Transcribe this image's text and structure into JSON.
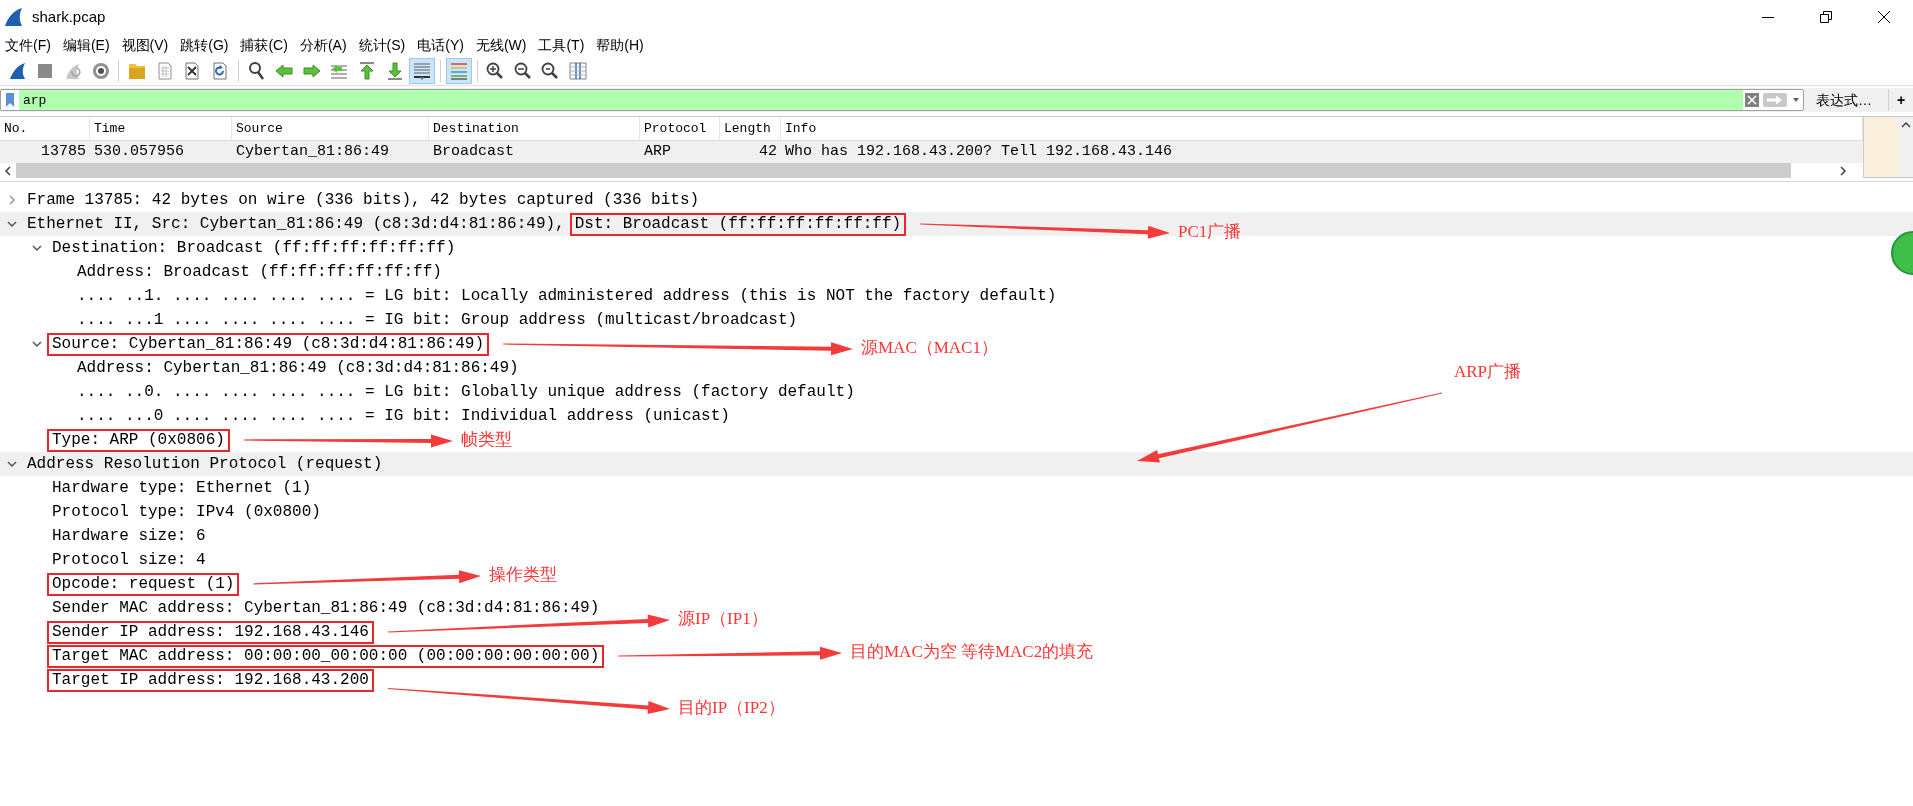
{
  "window": {
    "title": "shark.pcap"
  },
  "menu": [
    "文件(F)",
    "编辑(E)",
    "视图(V)",
    "跳转(G)",
    "捕获(C)",
    "分析(A)",
    "统计(S)",
    "电话(Y)",
    "无线(W)",
    "工具(T)",
    "帮助(H)"
  ],
  "toolbar": {
    "groups": [
      [
        {
          "selected": false
        },
        {
          "selected": false
        },
        {
          "selected": false
        },
        {
          "selected": false
        }
      ],
      [
        {
          "selected": false
        },
        {
          "selected": false
        },
        {
          "selected": false
        },
        {
          "selected": false
        }
      ],
      [
        {
          "selected": false
        },
        {
          "selected": false
        },
        {
          "selected": false
        },
        {
          "selected": false
        },
        {
          "selected": false
        },
        {
          "selected": false
        },
        {
          "selected": true
        }
      ],
      [
        {
          "selected": true
        }
      ],
      [
        {
          "selected": false
        },
        {
          "selected": false
        },
        {
          "selected": false
        },
        {
          "selected": false
        }
      ]
    ]
  },
  "filter": {
    "value": "arp",
    "expression_button": "表达式…",
    "add_button": "+"
  },
  "packet_list": {
    "columns": [
      "No.",
      "Time",
      "Source",
      "Destination",
      "Protocol",
      "Length",
      "Info"
    ],
    "rows": [
      {
        "cells": [
          "13785",
          "530.057956",
          "Cybertan_81:86:49",
          "Broadcast",
          "ARP",
          "42",
          "Who has 192.168.43.200? Tell 192.168.43.146"
        ]
      }
    ]
  },
  "details": [
    {
      "text": "Frame 13785: 42 bytes on wire (336 bits), 42 bytes captured (336 bits)",
      "expanded": false,
      "shaded": false,
      "boxed": false
    },
    {
      "text": "Ethernet II, Src: Cybertan_81:86:49 (c8:3d:d4:81:86:49),",
      "boxed_text": "Dst: Broadcast (ff:ff:ff:ff:ff:ff)",
      "expanded": true,
      "shaded": true,
      "boxed": false,
      "children": [
        {
          "text": "Destination: Broadcast (ff:ff:ff:ff:ff:ff)",
          "expanded": true,
          "boxed": false,
          "children": [
            {
              "text": "Address: Broadcast (ff:ff:ff:ff:ff:ff)",
              "boxed": false
            },
            {
              "text": ".... ..1. .... .... .... .... = LG bit: Locally administered address (this is NOT the factory default)",
              "boxed": false
            },
            {
              "text": ".... ...1 .... .... .... .... = IG bit: Group address (multicast/broadcast)",
              "boxed": false
            }
          ]
        },
        {
          "text": "Source: Cybertan_81:86:49 (c8:3d:d4:81:86:49)",
          "expanded": true,
          "boxed": true,
          "children": [
            {
              "text": "Address: Cybertan_81:86:49 (c8:3d:d4:81:86:49)",
              "boxed": false
            },
            {
              "text": ".... ..0. .... .... .... .... = LG bit: Globally unique address (factory default)",
              "boxed": false
            },
            {
              "text": ".... ...0 .... .... .... .... = IG bit: Individual address (unicast)",
              "boxed": false
            }
          ]
        },
        {
          "text": "Type: ARP (0x0806)",
          "boxed": true
        }
      ]
    },
    {
      "text": "Address Resolution Protocol (request)",
      "expanded": true,
      "shaded": true,
      "boxed": false,
      "children": [
        {
          "text": "Hardware type: Ethernet (1)",
          "boxed": false
        },
        {
          "text": "Protocol type: IPv4 (0x0800)",
          "boxed": false
        },
        {
          "text": "Hardware size: 6",
          "boxed": false
        },
        {
          "text": "Protocol size: 4",
          "boxed": false
        },
        {
          "text": "Opcode: request (1)",
          "boxed": true
        },
        {
          "text": "Sender MAC address: Cybertan_81:86:49 (c8:3d:d4:81:86:49)",
          "boxed": false
        },
        {
          "text": "Sender IP address: 192.168.43.146",
          "boxed": true
        },
        {
          "text": "Target MAC address: 00:00:00_00:00:00 (00:00:00:00:00:00)",
          "boxed": true
        },
        {
          "text": "Target IP address: 192.168.43.200",
          "boxed": true
        }
      ]
    }
  ],
  "annotations": [
    {
      "text": "PC1广播"
    },
    {
      "text": "源MAC（MAC1）"
    },
    {
      "text": "ARP广播"
    },
    {
      "text": "帧类型"
    },
    {
      "text": "操作类型"
    },
    {
      "text": "源IP（IP1）"
    },
    {
      "text": "目的MAC为空 等待MAC2的填充"
    },
    {
      "text": "目的IP（IP2）"
    }
  ]
}
